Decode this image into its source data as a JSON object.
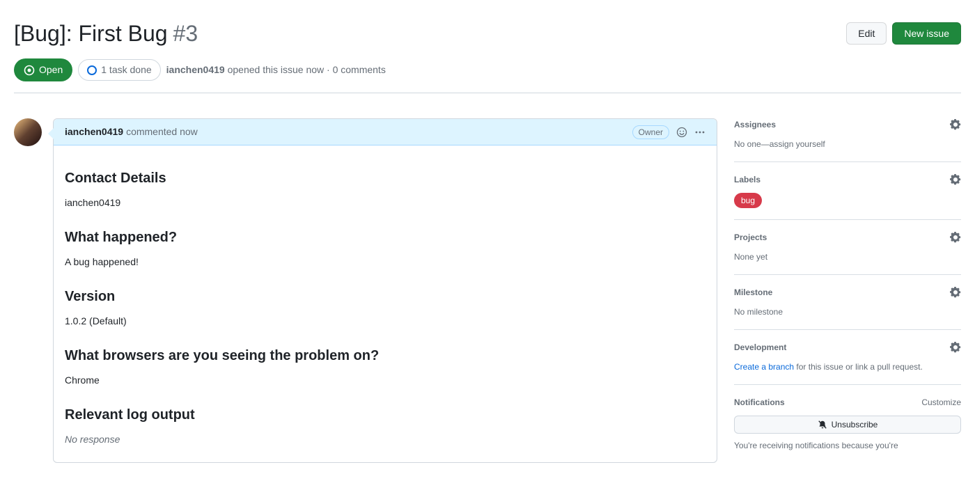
{
  "title": "[Bug]: First Bug",
  "issue_number": "#3",
  "buttons": {
    "edit": "Edit",
    "new_issue": "New issue"
  },
  "state": "Open",
  "tasks": "1 task done",
  "meta": {
    "author": "ianchen0419",
    "action": "opened this issue now · 0 comments"
  },
  "comment": {
    "author": "ianchen0419",
    "time": "commented now",
    "badge": "Owner",
    "sections": [
      {
        "heading": "Contact Details",
        "text": "ianchen0419"
      },
      {
        "heading": "What happened?",
        "text": "A bug happened!"
      },
      {
        "heading": "Version",
        "text": "1.0.2 (Default)"
      },
      {
        "heading": "What browsers are you seeing the problem on?",
        "text": "Chrome"
      },
      {
        "heading": "Relevant log output",
        "text": "No response",
        "italic": true
      }
    ]
  },
  "sidebar": {
    "assignees": {
      "label": "Assignees",
      "text_pre": "No one—",
      "link": "assign yourself"
    },
    "labels": {
      "label": "Labels",
      "chip": "bug"
    },
    "projects": {
      "label": "Projects",
      "text": "None yet"
    },
    "milestone": {
      "label": "Milestone",
      "text": "No milestone"
    },
    "development": {
      "label": "Development",
      "link": "Create a branch",
      "text": " for this issue or link a pull request."
    },
    "notifications": {
      "label": "Notifications",
      "customize": "Customize",
      "button": "Unsubscribe",
      "help": "You're receiving notifications because you're"
    }
  }
}
